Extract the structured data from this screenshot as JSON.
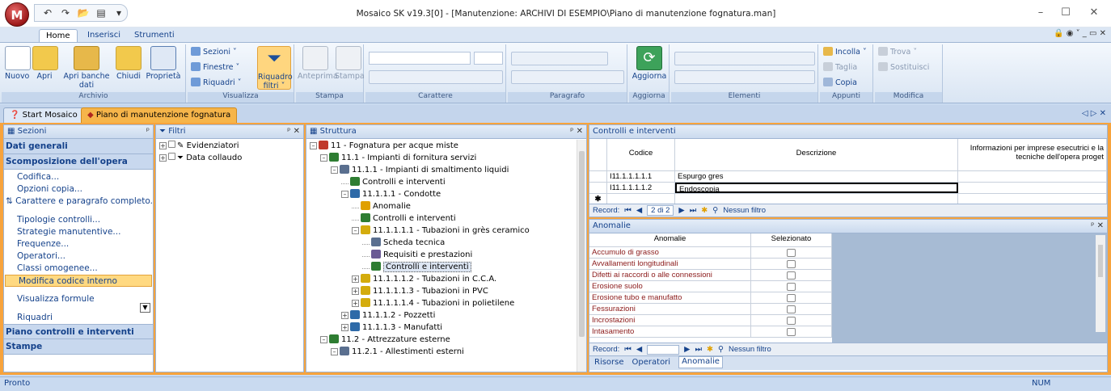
{
  "app": {
    "orb_label": "M",
    "title": "Mosaico SK v19.3[0] - [Manutenzione: ARCHIVI DI ESEMPIO\\Piano di manutenzione fognatura.man]",
    "window_controls": {
      "minimize": "–",
      "maximize": "☐",
      "close": "✕"
    }
  },
  "ribbon": {
    "tabs": [
      "Home",
      "Inserisci",
      "Strumenti"
    ],
    "right_controls": "🔒 ◉ ˅ _ ▭ ✕",
    "groups": {
      "archivio": {
        "label": "Archivio",
        "nuovo": "Nuovo",
        "apri": "Apri",
        "apri_banche_1": "Apri banche",
        "apri_banche_2": "dati",
        "chiudi": "Chiudi",
        "proprieta": "Proprietà"
      },
      "visualizza": {
        "label": "Visualizza",
        "sezioni": "Sezioni ˅",
        "finestre": "Finestre ˅",
        "riquadri": "Riquadri ˅",
        "riquadro_filtri_1": "Riquadro",
        "riquadro_filtri_2": "filtri ˅"
      },
      "stampa": {
        "label": "Stampa",
        "anteprima": "Anteprima",
        "stampa": "Stampa"
      },
      "carattere": {
        "label": "Carattere"
      },
      "paragrafo": {
        "label": "Paragrafo"
      },
      "aggiorna": {
        "label": "Aggiorna",
        "button": "Aggiorna"
      },
      "elementi": {
        "label": "Elementi"
      },
      "appunti": {
        "label": "Appunti",
        "incolla": "Incolla ˅",
        "taglia": "Taglia",
        "copia": "Copia"
      },
      "modifica": {
        "label": "Modifica",
        "trova": "Trova ˅",
        "sostituisci": "Sostituisci"
      }
    }
  },
  "doc_tabs": [
    {
      "label": "Start Mosaico",
      "active": false
    },
    {
      "label": "Piano di manutenzione fognatura",
      "active": true
    }
  ],
  "doc_tabs_right": "◁ ▷ ✕",
  "sezioni": {
    "title": "Sezioni",
    "pin": "ᵖ",
    "sections": [
      "Dati generali",
      "Scomposizione dell'opera",
      "Piano controlli e interventi",
      "Stampe"
    ],
    "links": [
      "Codifica...",
      "Opzioni copia...",
      "Carattere e paragrafo completo...",
      "Tipologie controlli...",
      "Strategie manutentive...",
      "Frequenze...",
      "Operatori...",
      "Classi omogenee...",
      "Modifica codice interno",
      "Visualizza formule",
      "Riquadri"
    ]
  },
  "filtri": {
    "title": "Filtri",
    "pin": "ᵖ ✕",
    "items": [
      "Evidenziatori",
      "Data collaudo"
    ]
  },
  "struttura": {
    "title": "Struttura",
    "pin": "ᵖ ✕",
    "nodes": [
      {
        "label": "11 - Fognatura per acque miste",
        "exp": "–"
      },
      {
        "label": "11.1 - Impianti di fornitura servizi",
        "exp": "–"
      },
      {
        "label": "11.1.1 - Impianti di smaltimento liquidi",
        "exp": "–"
      },
      {
        "label": "Controlli e interventi",
        "exp": ""
      },
      {
        "label": "11.1.1.1 - Condotte",
        "exp": "–"
      },
      {
        "label": "Anomalie",
        "exp": ""
      },
      {
        "label": "Controlli e interventi",
        "exp": ""
      },
      {
        "label": "11.1.1.1.1 - Tubazioni in grès ceramico",
        "exp": "–"
      },
      {
        "label": "Scheda tecnica",
        "exp": ""
      },
      {
        "label": "Requisiti e prestazioni",
        "exp": ""
      },
      {
        "label": "Controlli e interventi",
        "exp": ""
      },
      {
        "label": "11.1.1.1.2 - Tubazioni in C.C.A.",
        "exp": "+"
      },
      {
        "label": "11.1.1.1.3 - Tubazioni in PVC",
        "exp": "+"
      },
      {
        "label": "11.1.1.1.4 - Tubazioni in polietilene",
        "exp": "+"
      },
      {
        "label": "11.1.1.2 - Pozzetti",
        "exp": "+"
      },
      {
        "label": "11.1.1.3 - Manufatti",
        "exp": "+"
      },
      {
        "label": "11.2 - Attrezzature esterne",
        "exp": "–"
      },
      {
        "label": "11.2.1 - Allestimenti esterni",
        "exp": "–"
      }
    ]
  },
  "controlli": {
    "title": "Controlli e interventi",
    "columns": [
      "Codice",
      "Descrizione",
      "Informazioni per imprese esecutrici e la",
      "tecniche dell'opera proget"
    ],
    "rows": [
      {
        "codice": "I11.1.1.1.1.1",
        "descrizione": "Espurgo gres"
      },
      {
        "codice": "I11.1.1.1.1.2",
        "descrizione": "Endoscopia"
      }
    ],
    "new_row_marker": "✱",
    "nav": {
      "label": "Record:",
      "position": "2 di 2",
      "filter": "Nessun filtro"
    }
  },
  "anomalie": {
    "title": "Anomalie",
    "pin": "ᵖ ✕",
    "columns": [
      "Anomalie",
      "Selezionato"
    ],
    "rows": [
      "Accumulo di grasso",
      "Avvallamenti longitudinali",
      "Difetti ai raccordi o alle connessioni",
      "Erosione suolo",
      "Erosione tubo e manufatto",
      "Fessurazioni",
      "Incrostazioni",
      "Intasamento"
    ],
    "nav": {
      "label": "Record:",
      "filter": "Nessun filtro"
    },
    "tabs": [
      "Risorse",
      "Operatori",
      "Anomalie"
    ]
  },
  "status": {
    "left": "Pronto",
    "right": "NUM"
  },
  "colors": {
    "accent_orange": "#f7a33c",
    "link_blue": "#15428b",
    "anomaly_text": "#8b1a1a"
  }
}
